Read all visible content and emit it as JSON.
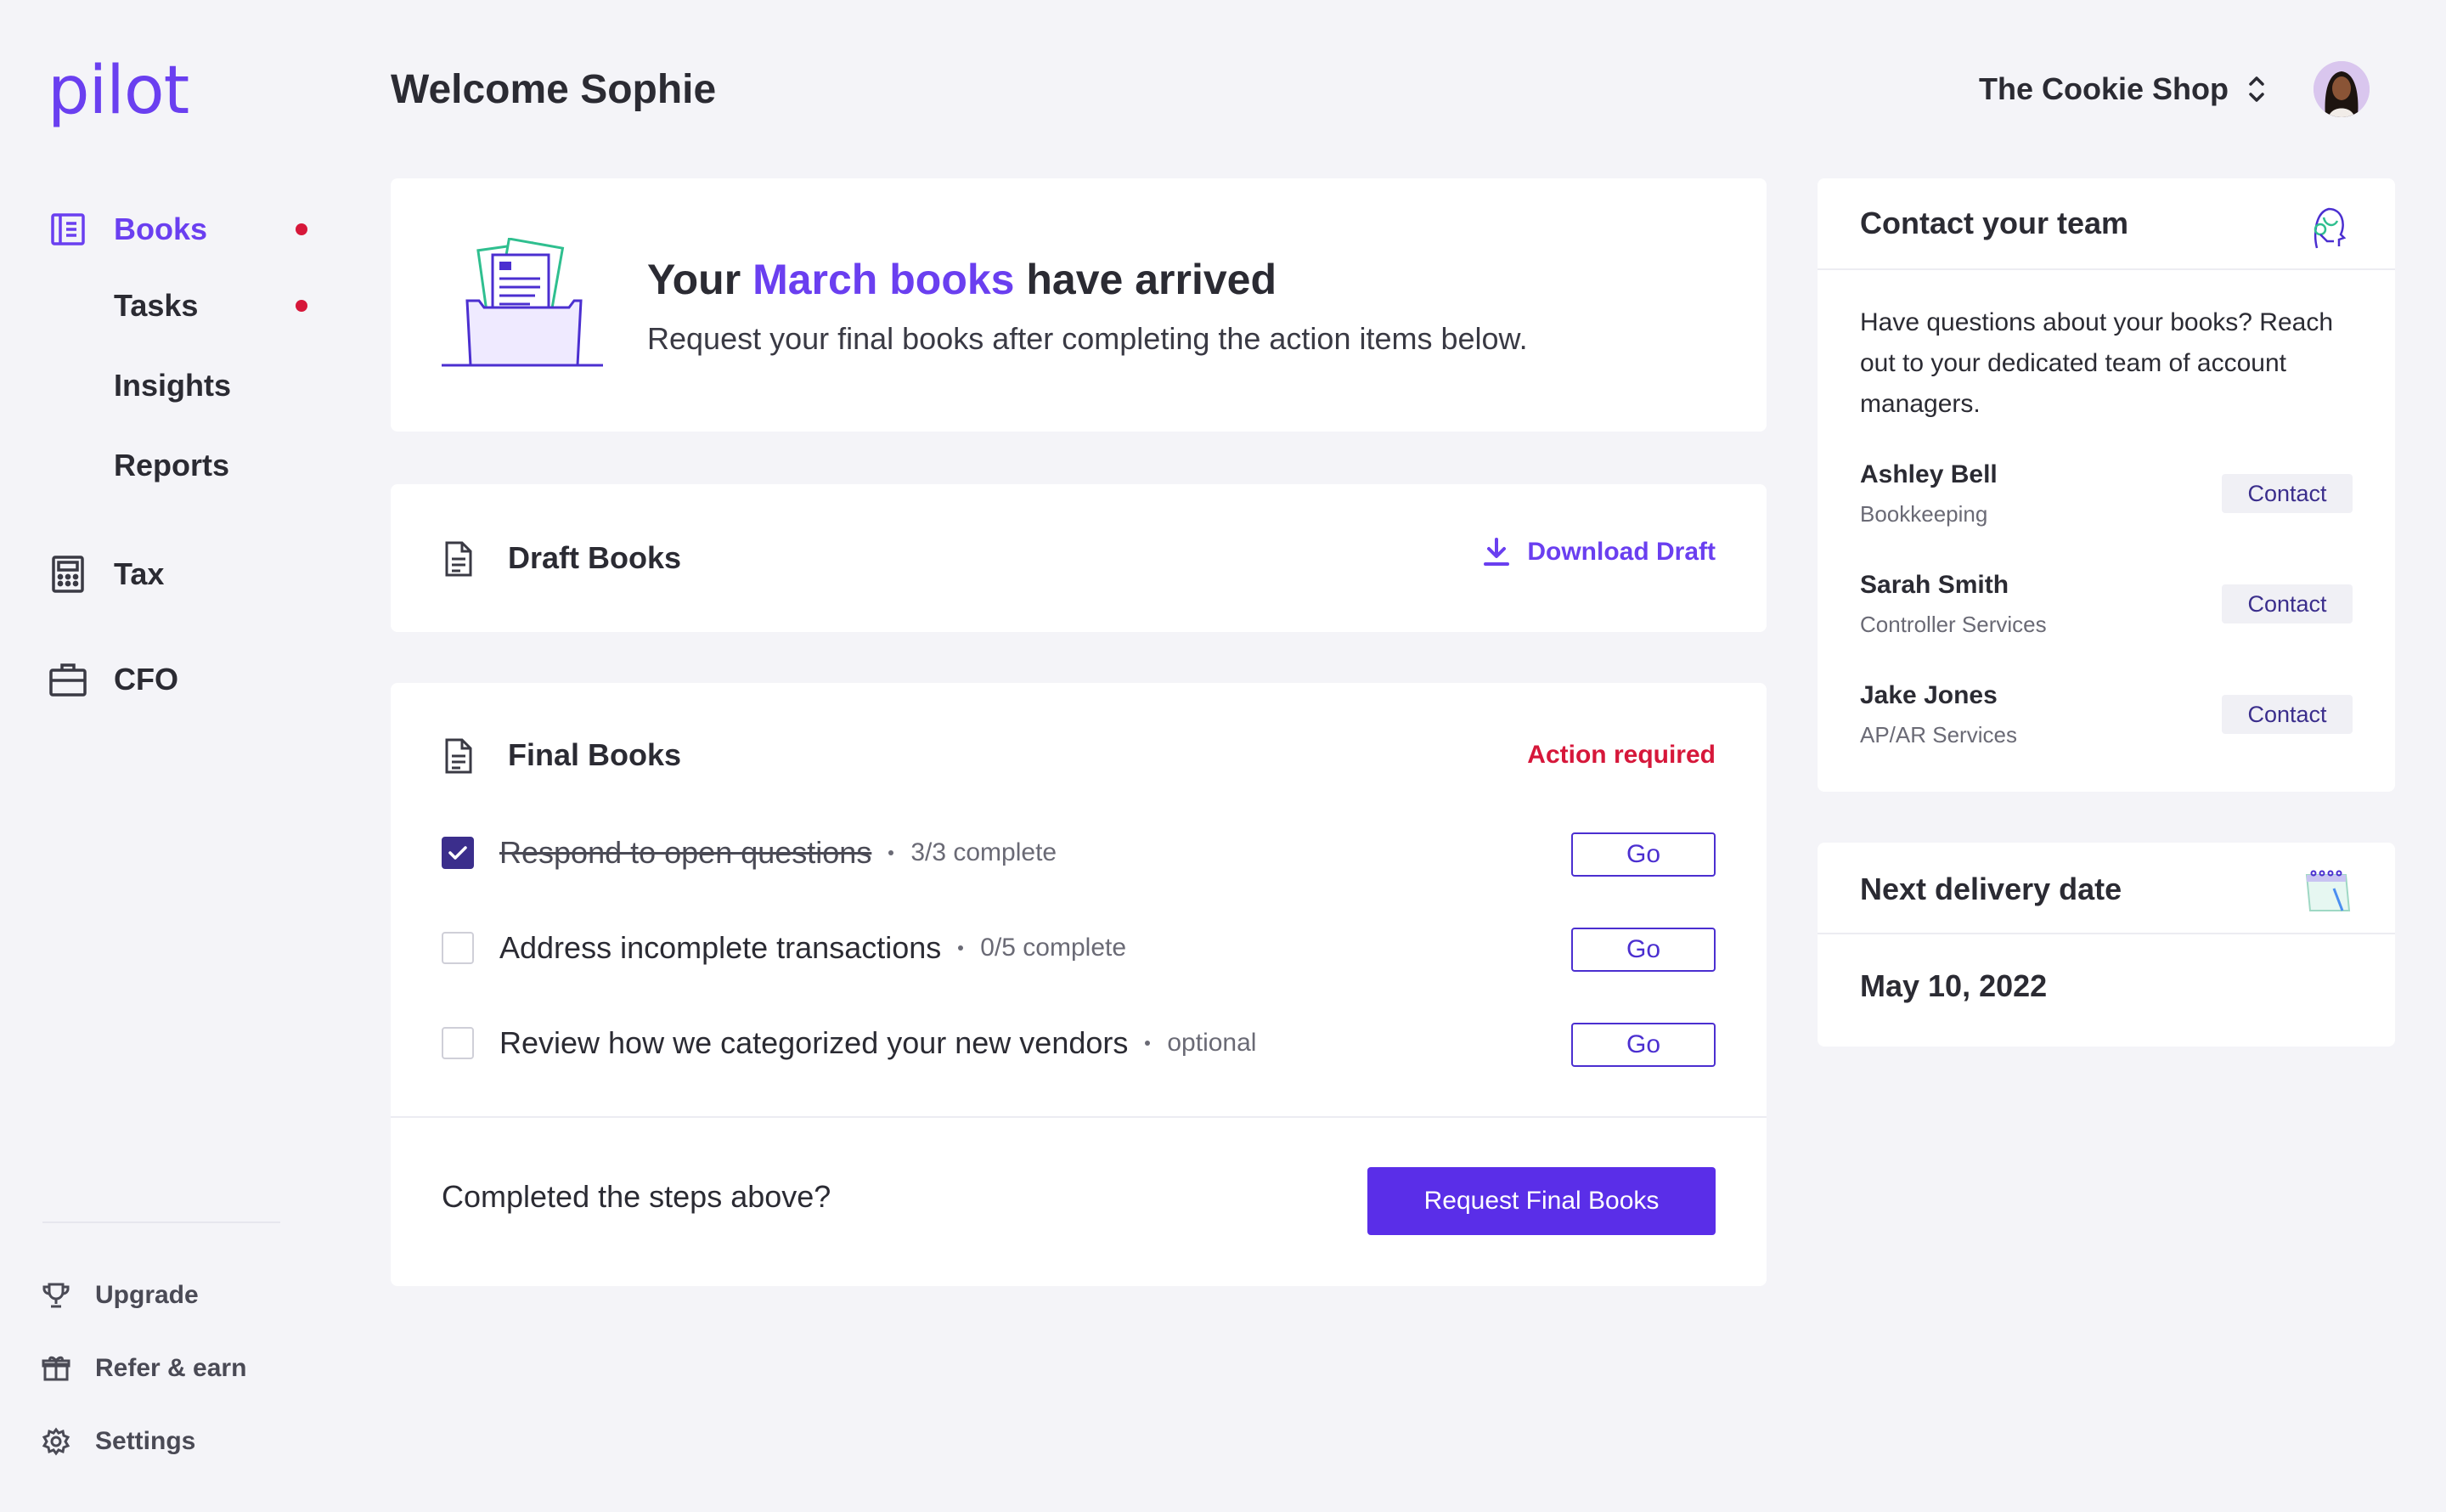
{
  "app": {
    "logo": "pilot"
  },
  "sidebar": {
    "items": [
      {
        "label": "Books",
        "active": true,
        "badge": true,
        "icon": "book-icon"
      },
      {
        "label": "Tasks",
        "active": false,
        "badge": true
      },
      {
        "label": "Insights",
        "active": false,
        "badge": false
      },
      {
        "label": "Reports",
        "active": false,
        "badge": false
      },
      {
        "label": "Tax",
        "active": false,
        "badge": false,
        "icon": "calculator-icon"
      },
      {
        "label": "CFO",
        "active": false,
        "badge": false,
        "icon": "briefcase-icon"
      }
    ],
    "bottom": [
      {
        "label": "Upgrade",
        "icon": "trophy-icon"
      },
      {
        "label": "Refer & earn",
        "icon": "gift-icon"
      },
      {
        "label": "Settings",
        "icon": "gear-icon"
      }
    ]
  },
  "header": {
    "welcome": "Welcome Sophie",
    "company": "The Cookie Shop"
  },
  "hero": {
    "title_pre": "Your ",
    "title_accent": "March books",
    "title_post": " have arrived",
    "subtitle": "Request your final books after completing the action items below."
  },
  "draft": {
    "title": "Draft Books",
    "download_label": "Download Draft"
  },
  "final": {
    "title": "Final Books",
    "status": "Action required",
    "tasks": [
      {
        "label": "Respond to open questions",
        "meta": "3/3 complete",
        "done": true,
        "button": "Go"
      },
      {
        "label": "Address incomplete transactions",
        "meta": "0/5 complete",
        "done": false,
        "button": "Go"
      },
      {
        "label": "Review how we categorized your new vendors",
        "meta": "optional",
        "done": false,
        "button": "Go"
      }
    ],
    "completed_prompt": "Completed the steps above?",
    "request_button": "Request Final Books"
  },
  "contact": {
    "title": "Contact your team",
    "intro": "Have questions about your books? Reach out to your dedicated team of account managers.",
    "members": [
      {
        "name": "Ashley Bell",
        "role": "Bookkeeping",
        "button": "Contact"
      },
      {
        "name": "Sarah Smith",
        "role": "Controller Services",
        "button": "Contact"
      },
      {
        "name": "Jake Jones",
        "role": "AP/AR Services",
        "button": "Contact"
      }
    ]
  },
  "delivery": {
    "title": "Next delivery date",
    "date": "May 10, 2022"
  },
  "colors": {
    "accent": "#6a3ff0",
    "primary_button": "#5a2ee8",
    "alert": "#d6173a",
    "checkbox_checked": "#3b2e8c",
    "background": "#f4f4f8"
  }
}
